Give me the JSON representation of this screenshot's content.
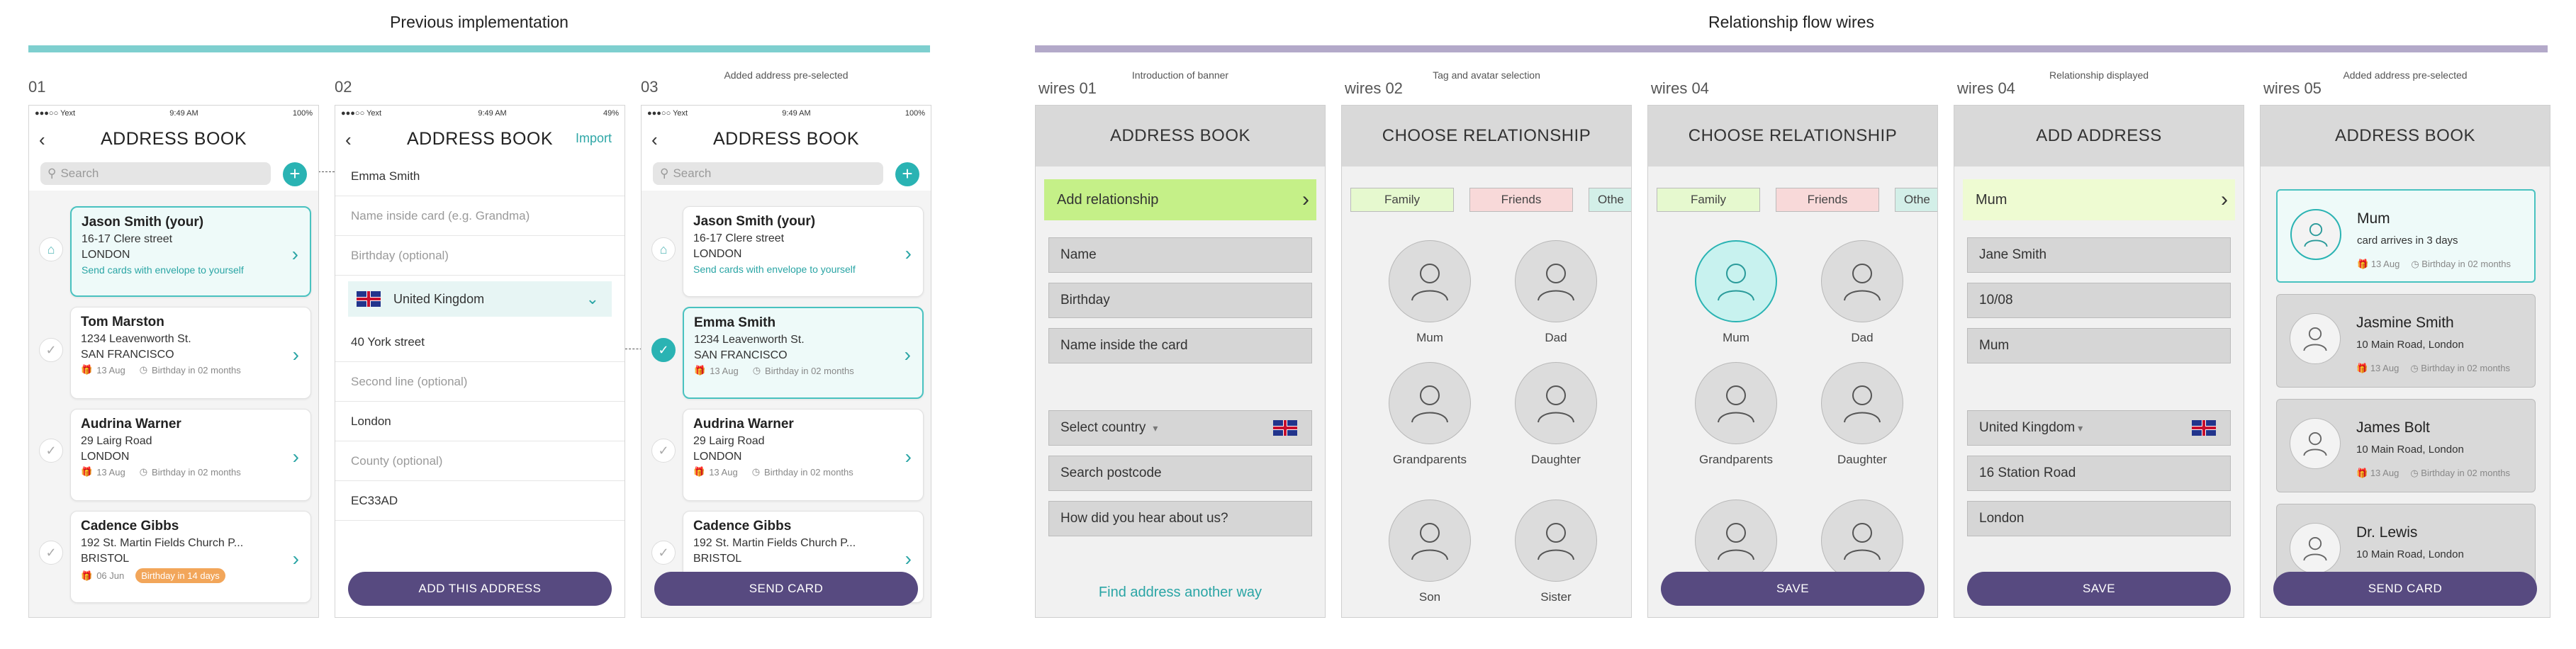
{
  "sections": {
    "left_title": "Previous implementation",
    "left_bar_color": "#7ecfcf",
    "right_title": "Relationship flow wires",
    "right_bar_color": "#b3a9c9"
  },
  "columns": {
    "c01": "01",
    "c02": "02",
    "c03": "03",
    "c03_caption": "Added address pre-selected",
    "w01": "wires 01",
    "w01_caption": "Introduction of banner",
    "w02": "wires 02",
    "w02_caption": "Tag and  avatar selection",
    "w04a": "wires 04",
    "w04b": "wires 04",
    "w04b_caption": "Relationship displayed",
    "w05": "wires 05",
    "w05_caption": "Added address pre-selected"
  },
  "status_bar": {
    "carrier": "●●●○○ Yext",
    "time": "9:49 AM",
    "battery_full": "100%",
    "battery_half": "49%"
  },
  "phone01": {
    "title": "ADDRESS BOOK",
    "search_placeholder": "Search",
    "cards": [
      {
        "name": "Jason Smith (your)",
        "line1": "16-17 Clere street",
        "line2": "LONDON",
        "send": "Send cards with envelope to yourself"
      },
      {
        "name": "Tom Marston",
        "line1": "1234 Leavenworth St.",
        "line2": "SAN FRANCISCO",
        "date": "13 Aug",
        "birthday": "Birthday in 02 months"
      },
      {
        "name": "Audrina Warner",
        "line1": "29 Lairg Road",
        "line2": "LONDON",
        "date": "13 Aug",
        "birthday": "Birthday in 02 months"
      },
      {
        "name": "Cadence Gibbs",
        "line1": "192 St. Martin Fields Church P...",
        "line2": "BRISTOL",
        "date": "06 Jun",
        "birthday": "Birthday in 14 days"
      }
    ]
  },
  "phone02": {
    "title": "ADDRESS BOOK",
    "import": "Import",
    "rows": [
      {
        "text": "Emma Smith",
        "placeholder": false
      },
      {
        "text": "Name inside card (e.g. Grandma)",
        "placeholder": true
      },
      {
        "text": "Birthday (optional)",
        "placeholder": true
      }
    ],
    "country": "United Kingdom",
    "rows2": [
      {
        "text": "40 York street",
        "placeholder": false
      },
      {
        "text": "Second line (optional)",
        "placeholder": true
      },
      {
        "text": "London",
        "placeholder": false
      },
      {
        "text": "County (optional)",
        "placeholder": true
      },
      {
        "text": "EC33AD",
        "placeholder": false
      }
    ],
    "button": "ADD THIS ADDRESS"
  },
  "phone03": {
    "title": "ADDRESS BOOK",
    "search_placeholder": "Search",
    "cards": [
      {
        "name": "Jason Smith (your)",
        "line1": "16-17 Clere street",
        "line2": "LONDON",
        "send": "Send cards with envelope to yourself"
      },
      {
        "name": "Emma Smith",
        "line1": "1234 Leavenworth St.",
        "line2": "SAN FRANCISCO",
        "date": "13 Aug",
        "birthday": "Birthday in 02 months"
      },
      {
        "name": "Audrina Warner",
        "line1": "29 Lairg Road",
        "line2": "LONDON",
        "date": "13 Aug",
        "birthday": "Birthday in 02 months"
      },
      {
        "name": "Cadence Gibbs",
        "line1": "192 St. Martin Fields Church P...",
        "line2": "BRISTOL"
      }
    ],
    "button": "SEND CARD"
  },
  "wire01": {
    "title": "ADDRESS BOOK",
    "banner": "Add relationship",
    "fields": [
      "Name",
      "Birthday",
      "Name inside the card"
    ],
    "country": "Select country",
    "postcode": "Search postcode",
    "hear": "How did you hear about us?",
    "link": "Find address another way"
  },
  "wire02": {
    "title": "CHOOSE RELATIONSHIP",
    "tags": [
      "Family",
      "Friends",
      "Othe"
    ],
    "avatars": [
      "Mum",
      "Dad",
      "Grandparents",
      "Daughter",
      "Son",
      "Sister"
    ]
  },
  "wire04a": {
    "title": "CHOOSE RELATIONSHIP",
    "tags": [
      "Family",
      "Friends",
      "Othe"
    ],
    "avatars": [
      "Mum",
      "Dad",
      "Grandparents",
      "Daughter"
    ],
    "button": "SAVE"
  },
  "wire04b": {
    "title": "ADD ADDRESS",
    "banner": "Mum",
    "fields": [
      "Jane Smith",
      "10/08",
      "Mum"
    ],
    "country": "United Kingdom",
    "address1": "16 Station Road",
    "address2": "London",
    "button": "SAVE"
  },
  "wire05": {
    "title": "ADDRESS BOOK",
    "cards": [
      {
        "name": "Mum",
        "sub": "card arrives in 3 days",
        "date": "13 Aug",
        "birthday": "Birthday in 02 months"
      },
      {
        "name": "Jasmine Smith",
        "sub": "10 Main Road, London",
        "date": "13 Aug",
        "birthday": "Birthday in 02 months"
      },
      {
        "name": "James Bolt",
        "sub": "10 Main Road, London",
        "date": "13 Aug",
        "birthday": "Birthday in 02 months"
      },
      {
        "name": "Dr. Lewis",
        "sub": "10 Main Road, London"
      }
    ],
    "button": "SEND CARD"
  }
}
